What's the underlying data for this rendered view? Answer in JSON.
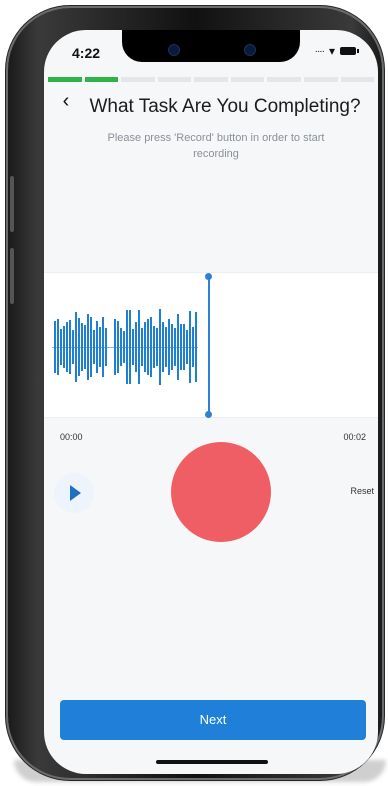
{
  "status_bar": {
    "time": "4:22"
  },
  "progress": {
    "total_steps": 9,
    "completed_steps": 2,
    "color_done": "#2db34a",
    "color_todo": "#e4e6ea"
  },
  "header": {
    "back_icon": "chevron-left-icon",
    "title": "What Task Are You Completing?",
    "subtitle": "Please press 'Record' button in order to start recording"
  },
  "recorder": {
    "time_start": "00:00",
    "time_end": "00:02",
    "reset_label": "Reset",
    "play_icon": "play-icon",
    "record_color": "#ef5e65",
    "waveform_color": "#1f7fd4"
  },
  "footer": {
    "next_label": "Next",
    "button_color": "#1f7fd9"
  }
}
